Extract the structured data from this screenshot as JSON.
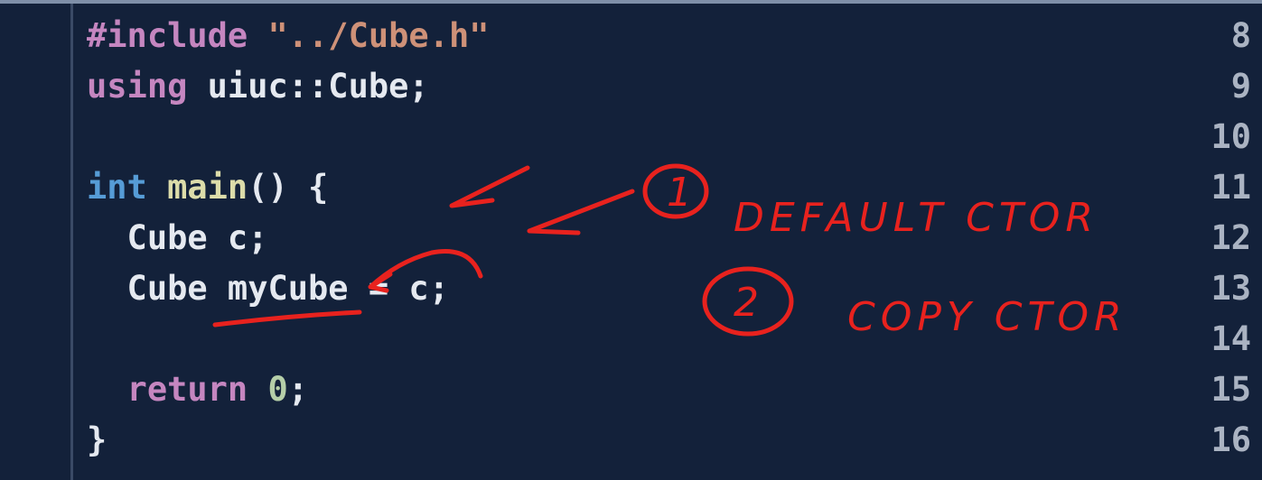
{
  "editor": {
    "lines": [
      {
        "num": "8",
        "tokens": [
          {
            "t": "#include ",
            "c": "kw"
          },
          {
            "t": "\"../Cube.h\"",
            "c": "str"
          }
        ]
      },
      {
        "num": "9",
        "tokens": [
          {
            "t": "using ",
            "c": "kw"
          },
          {
            "t": "uiuc::Cube;",
            "c": "plain"
          }
        ]
      },
      {
        "num": "10",
        "tokens": []
      },
      {
        "num": "11",
        "tokens": [
          {
            "t": "int ",
            "c": "type"
          },
          {
            "t": "main",
            "c": "fn"
          },
          {
            "t": "() {",
            "c": "plain"
          }
        ]
      },
      {
        "num": "12",
        "tokens": [
          {
            "t": "  Cube c;",
            "c": "plain"
          }
        ]
      },
      {
        "num": "13",
        "tokens": [
          {
            "t": "  Cube myCube = c;",
            "c": "plain"
          }
        ]
      },
      {
        "num": "14",
        "tokens": []
      },
      {
        "num": "15",
        "tokens": [
          {
            "t": "  return ",
            "c": "kw"
          },
          {
            "t": "0",
            "c": "num"
          },
          {
            "t": ";",
            "c": "plain"
          }
        ]
      },
      {
        "num": "16",
        "tokens": [
          {
            "t": "}",
            "c": "plain"
          }
        ]
      }
    ]
  },
  "annotations": {
    "circle_1_label": "1",
    "note_1": "DEFAULT  CTOR",
    "circle_2_label": "2",
    "note_2": "COPY  CTOR",
    "ink_color": "#e8221e"
  }
}
